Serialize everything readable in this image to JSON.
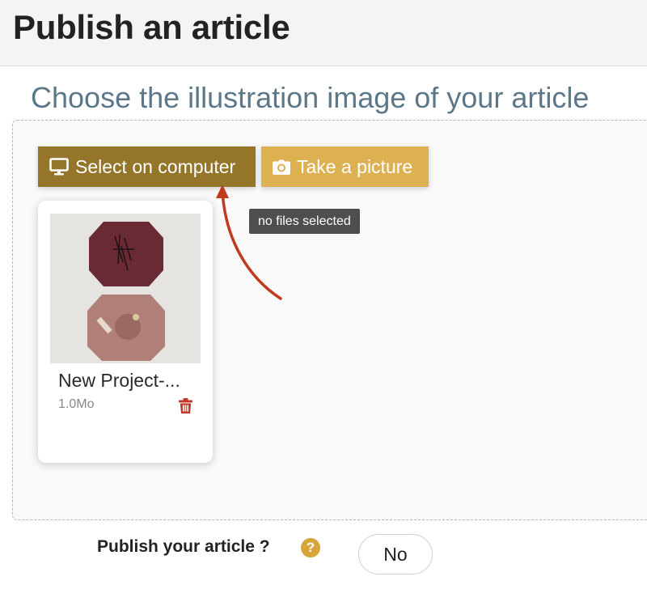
{
  "header": {
    "title": "Publish an article"
  },
  "upload": {
    "section_title": "Choose the illustration image of your article",
    "select_button": {
      "label": "Select on computer",
      "icon": "monitor-icon"
    },
    "camera_button": {
      "label": "Take a picture",
      "icon": "camera-icon"
    },
    "tooltip": "no files selected"
  },
  "file_card": {
    "name": "New Project-...",
    "size": "1.0Mo",
    "delete_icon": "trash-icon"
  },
  "publish": {
    "label": "Publish your article ?",
    "help_icon": "question-icon",
    "help_glyph": "?",
    "toggle_value": "No"
  },
  "colors": {
    "select_button_bg": "#94752a",
    "camera_button_bg": "#ddb151",
    "title_blue": "#5c7788",
    "annotation_arrow": "#c03a1e",
    "delete_red": "#c0392b"
  }
}
